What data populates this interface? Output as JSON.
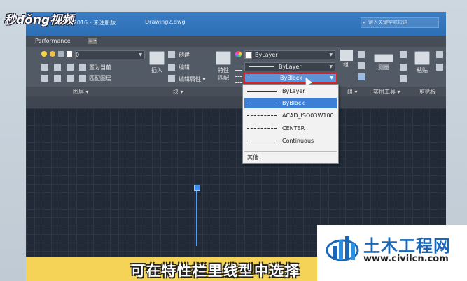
{
  "logo": {
    "text": "秒dǒng视频"
  },
  "window": {
    "title": "CAD 2016 - 未注册版",
    "filename": "Drawing2.dwg",
    "search_placeholder": "键入关键字或短语"
  },
  "tabs": {
    "performance": "Performance",
    "tag": "▭ ▾"
  },
  "ribbon": {
    "layers": {
      "layer_value": "0",
      "set_current": "置为当前",
      "match_layer": "匹配图层",
      "footer": "图层 ▾"
    },
    "block": {
      "insert": "插入",
      "create": "创建",
      "edit": "编辑",
      "edit_attr": "编辑属性 ▾",
      "footer": "块 ▾"
    },
    "properties": {
      "match_label": "特性\n匹配",
      "match_1": "特性",
      "match_2": "匹配",
      "color_value": "ByLayer",
      "lineweight_value": "ByLayer",
      "linetype_value": "ByBlock"
    },
    "groups": {
      "group": "组",
      "footer": "组 ▾"
    },
    "utilities": {
      "measure": "测量",
      "footer": "实用工具 ▾"
    },
    "clipboard": {
      "paste": "粘贴",
      "footer": "剪贴板"
    }
  },
  "linetype_menu": {
    "items": [
      {
        "label": "ByLayer",
        "selected": false
      },
      {
        "label": "ByBlock",
        "selected": true
      },
      {
        "label": "ACAD_ISO03W100",
        "selected": false
      },
      {
        "label": "CENTER",
        "selected": false
      },
      {
        "label": "Continuous",
        "selected": false
      }
    ],
    "other": "其他..."
  },
  "subtitle": "可在特性栏里线型中选择",
  "watermark": {
    "name": "土木工程网",
    "url": "www.civilcn.com"
  },
  "colors": {
    "accent": "#3d7fd6",
    "highlight_border": "#e02424",
    "line": "#4aa0ff",
    "subtitle_bg": "#f4d356"
  }
}
